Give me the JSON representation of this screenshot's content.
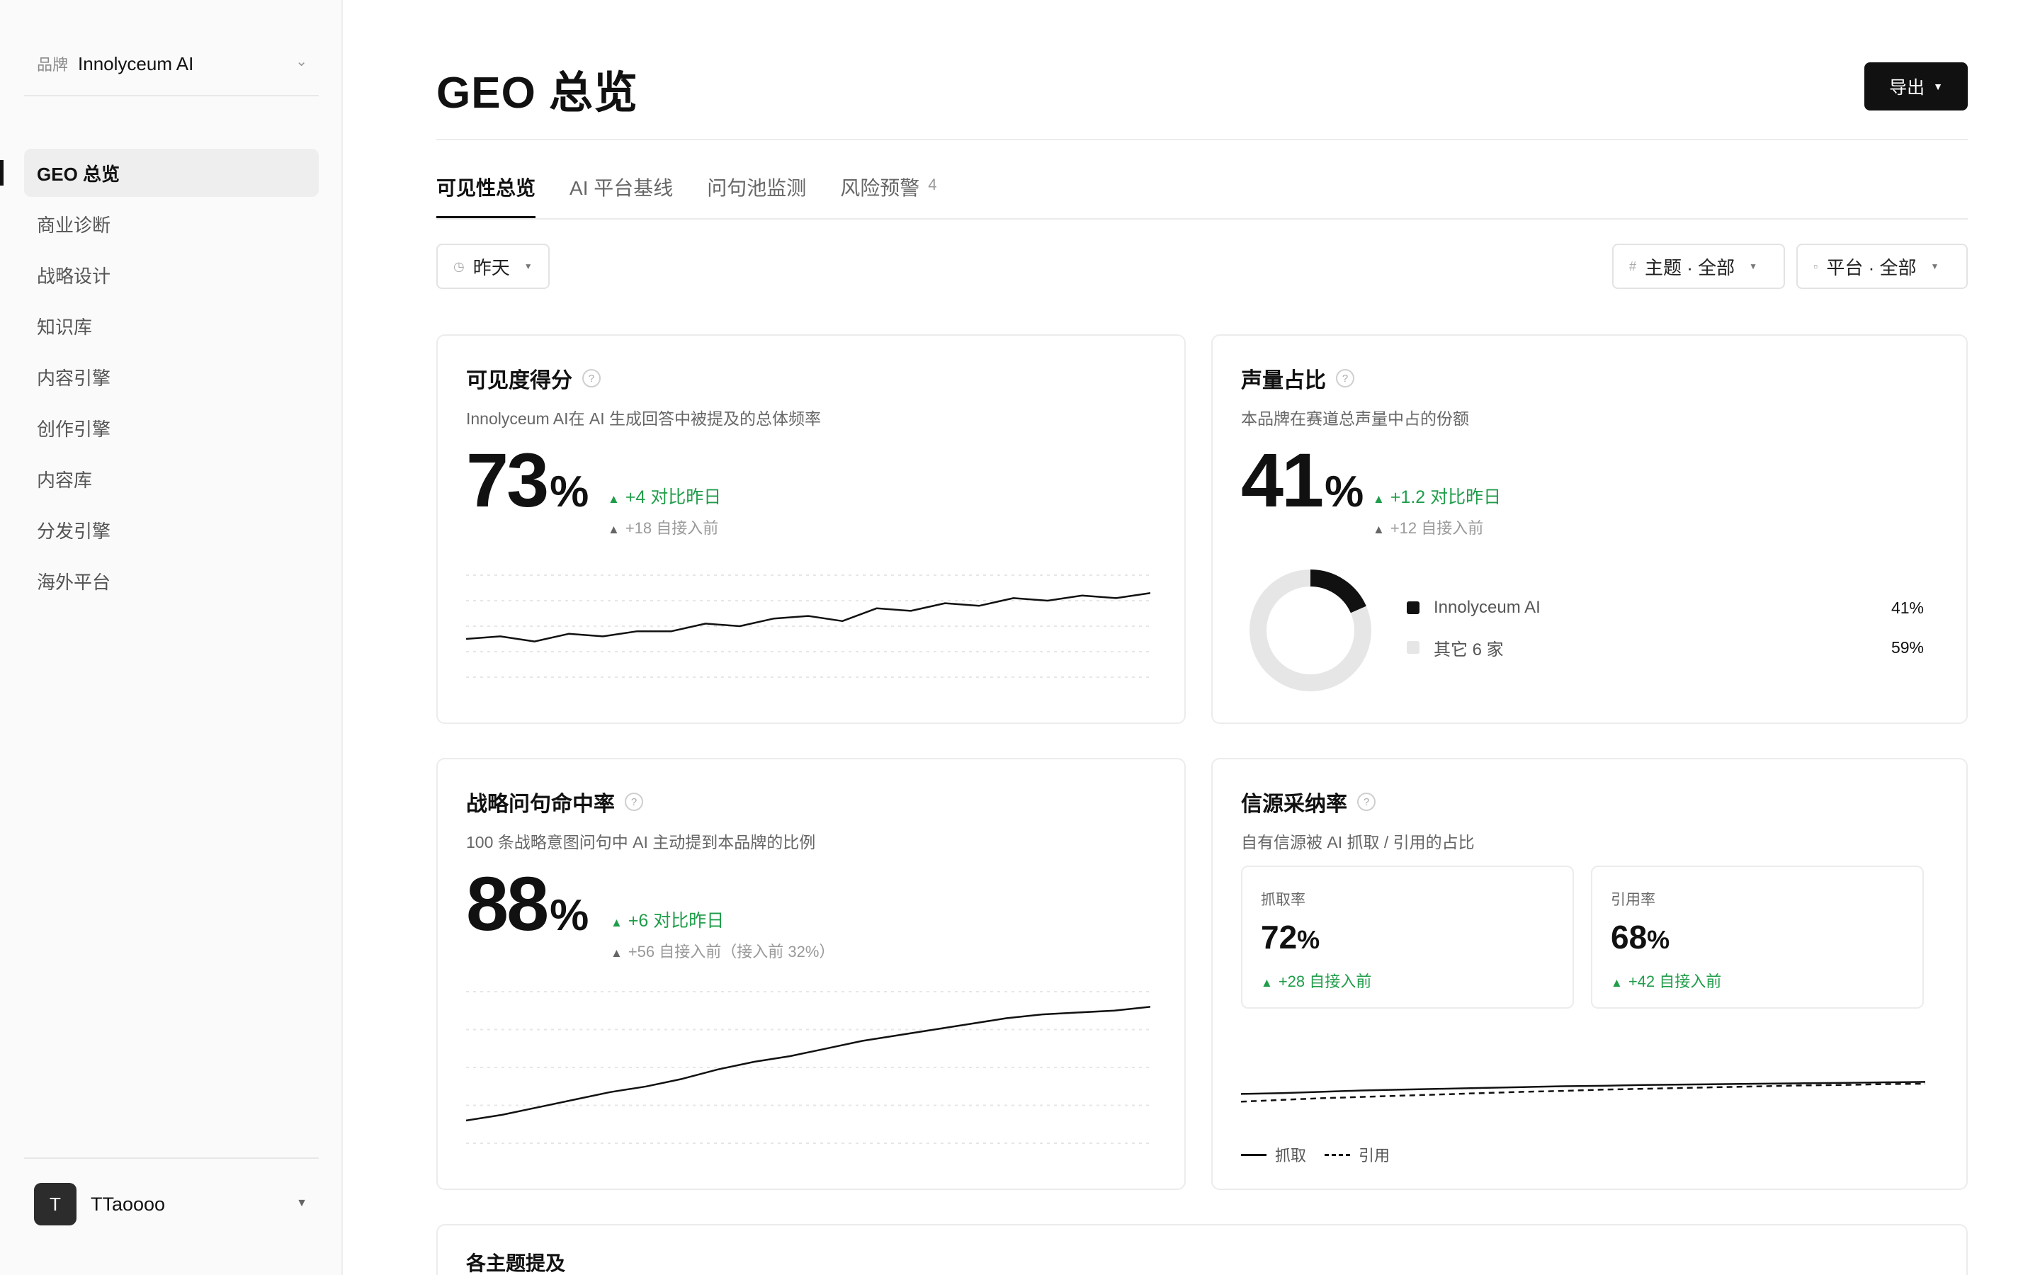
{
  "sidebar": {
    "brand_prefix": "品牌",
    "brand_name": "Innolyceum AI",
    "items": [
      {
        "label": "GEO 总览",
        "active": true
      },
      {
        "label": "商业诊断"
      },
      {
        "label": "战略设计"
      },
      {
        "label": "知识库"
      },
      {
        "label": "内容引擎"
      },
      {
        "label": "创作引擎"
      },
      {
        "label": "内容库"
      },
      {
        "label": "分发引擎"
      },
      {
        "label": "海外平台"
      }
    ],
    "user": {
      "initial": "T",
      "name": "TTaoooo"
    }
  },
  "header": {
    "title": "GEO 总览",
    "export_label": "导出"
  },
  "tabs": [
    {
      "label": "可见性总览",
      "active": true
    },
    {
      "label": "AI 平台基线"
    },
    {
      "label": "问句池监测"
    },
    {
      "label": "风险预警",
      "badge": "4"
    }
  ],
  "filters": {
    "date": "昨天",
    "topic": "主题 · 全部",
    "platform": "平台 · 全部"
  },
  "cards": {
    "visibility": {
      "title": "可见度得分",
      "desc": "Innolyceum AI在 AI 生成回答中被提及的总体频率",
      "value": "73",
      "unit": "%",
      "delta": "+4 对比昨日",
      "delta2": "+18 自接入前"
    },
    "share": {
      "title": "声量占比",
      "desc": "本品牌在赛道总声量中占的份额",
      "value": "41",
      "unit": "%",
      "delta": "+1.2 对比昨日",
      "delta2": "+12 自接入前",
      "legend": [
        {
          "name": "Innolyceum AI",
          "value": "41%",
          "color": "#111111"
        },
        {
          "name": "其它 6 家",
          "value": "59%",
          "color": "#e6e6e6"
        }
      ]
    },
    "hit_rate": {
      "title": "战略问句命中率",
      "desc": "100 条战略意图问句中 AI 主动提到本品牌的比例",
      "value": "88",
      "unit": "%",
      "delta": "+6 对比昨日",
      "delta2": "+56 自接入前（接入前 32%）"
    },
    "source": {
      "title": "信源采纳率",
      "desc": "自有信源被 AI 抓取 / 引用的占比",
      "crawl": {
        "label": "抓取率",
        "value": "72",
        "unit": "%",
        "delta": "+28 自接入前"
      },
      "cite": {
        "label": "引用率",
        "value": "68",
        "unit": "%",
        "delta": "+42 自接入前"
      },
      "legend_crawl": "抓取",
      "legend_cite": "引用"
    },
    "topics": {
      "title": "各主题提及"
    }
  },
  "chart_data": [
    {
      "type": "line",
      "series": [
        {
          "values": [
            55,
            56,
            54,
            57,
            56,
            58,
            58,
            61,
            60,
            63,
            64,
            62,
            67,
            66,
            69,
            68,
            71,
            70,
            72,
            71,
            73
          ]
        }
      ],
      "ylim": [
        40,
        80
      ]
    },
    {
      "type": "pie",
      "categories": [
        "Innolyceum AI",
        "其它 6 家"
      ],
      "values": [
        41,
        59
      ]
    },
    {
      "type": "line",
      "series": [
        {
          "values": [
            32,
            35,
            39,
            43,
            47,
            50,
            54,
            59,
            63,
            66,
            70,
            74,
            77,
            80,
            83,
            86,
            88,
            89,
            90,
            92
          ]
        }
      ],
      "ylim": [
        20,
        100
      ]
    },
    {
      "type": "line",
      "series": [
        {
          "name": "抓取",
          "values": [
            44,
            46,
            49,
            52,
            54,
            56,
            58,
            60,
            62,
            63,
            65,
            66,
            67,
            68,
            69,
            70,
            71,
            72
          ]
        },
        {
          "name": "引用",
          "values": [
            26,
            30,
            34,
            37,
            40,
            43,
            46,
            49,
            51,
            54,
            56,
            58,
            60,
            62,
            64,
            65,
            67,
            68
          ]
        }
      ],
      "ylim": [
        0,
        100
      ]
    }
  ]
}
